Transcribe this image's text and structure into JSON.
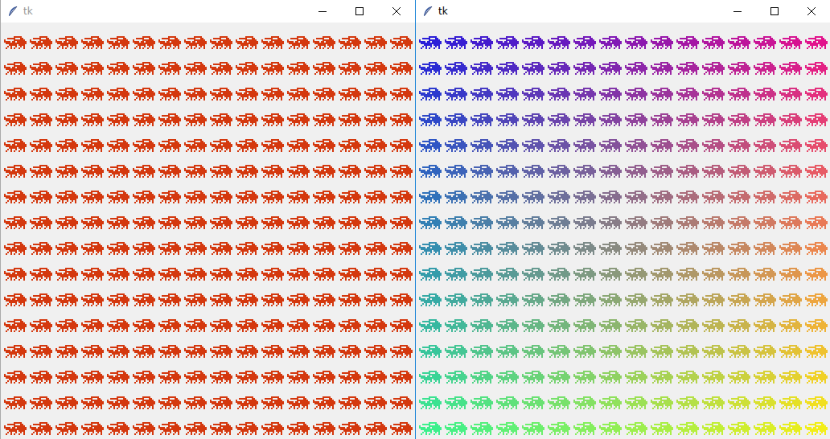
{
  "windows": [
    {
      "title": "tk",
      "active": false,
      "sprites": {
        "rows": 16,
        "columns": 16
      },
      "colors": {
        "top_left": "#d4380e",
        "top_right": "#d4380e",
        "bottom_left": "#d4380e",
        "bottom_right": "#d4380e"
      }
    },
    {
      "title": "tk",
      "active": true,
      "sprites": {
        "rows": 16,
        "columns": 16
      },
      "colors": {
        "top_left": "#2a1ed8",
        "top_right": "#e2128c",
        "bottom_left": "#3cf08c",
        "bottom_right": "#f2ee18"
      }
    }
  ]
}
